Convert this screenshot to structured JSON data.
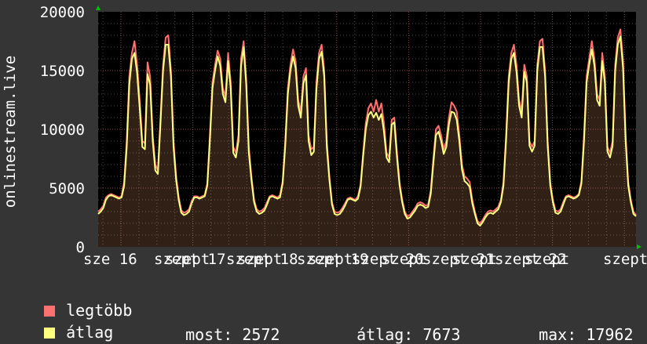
{
  "chart_data": {
    "type": "area",
    "ylabel": "onlinestream.live",
    "ylim": [
      0,
      20000
    ],
    "yticks": [
      0,
      5000,
      10000,
      15000,
      20000
    ],
    "ytick_labels": [
      "0",
      "5000",
      "10000",
      "15000",
      "20000"
    ],
    "x_tick_labels": [
      "sze 16",
      "szept 17",
      "szept 18",
      "szept 19",
      "szept 20",
      "szept 21",
      "szept 22",
      "szept"
    ],
    "x_tick_overlap_labels": [
      "szept",
      "szept",
      "szept",
      "szept",
      "szept",
      "szept"
    ],
    "grid": true,
    "background": "#000000",
    "series": [
      {
        "name": "legtöbb",
        "color": "#ff7070",
        "values": [
          3000,
          3200,
          3500,
          4200,
          4400,
          4500,
          4400,
          4300,
          4200,
          4300,
          5500,
          9000,
          14500,
          16500,
          17500,
          15500,
          12500,
          9000,
          8800,
          15700,
          14500,
          9500,
          7000,
          6500,
          11000,
          15500,
          17800,
          18000,
          15000,
          9000,
          6000,
          4200,
          3100,
          2900,
          3000,
          3200,
          3900,
          4300,
          4300,
          4200,
          4300,
          4400,
          5400,
          9500,
          14000,
          15500,
          16700,
          16000,
          13500,
          12800,
          16500,
          14000,
          8500,
          8000,
          9500,
          16000,
          17500,
          14200,
          8500,
          6000,
          4000,
          3200,
          3000,
          3100,
          3300,
          3800,
          4300,
          4400,
          4300,
          4200,
          4400,
          5600,
          9000,
          13500,
          15500,
          16800,
          15800,
          12500,
          11500,
          14500,
          15200,
          9500,
          8300,
          8500,
          14000,
          16500,
          17200,
          15000,
          9000,
          6000,
          3800,
          3000,
          2900,
          3000,
          3300,
          3700,
          4100,
          4200,
          4100,
          4000,
          4300,
          5300,
          8000,
          10500,
          11800,
          12200,
          11500,
          12500,
          11500,
          12200,
          10500,
          8000,
          7600,
          10800,
          11000,
          8000,
          5500,
          4000,
          3000,
          2600,
          2700,
          3000,
          3300,
          3700,
          3800,
          3700,
          3500,
          3600,
          4800,
          7500,
          10000,
          10300,
          9500,
          8300,
          9000,
          11000,
          12300,
          12000,
          11500,
          9500,
          7000,
          6000,
          5800,
          5500,
          4000,
          3000,
          2200,
          2000,
          2300,
          2700,
          3000,
          3100,
          3000,
          3200,
          3400,
          4000,
          5500,
          9500,
          14500,
          16500,
          17200,
          15500,
          12500,
          11500,
          15500,
          14500,
          9000,
          8500,
          9000,
          15500,
          17500,
          17700,
          15000,
          9000,
          5500,
          4000,
          3100,
          3000,
          3200,
          3800,
          4300,
          4400,
          4300,
          4200,
          4300,
          4500,
          5600,
          9500,
          14500,
          16000,
          17500,
          16000,
          13000,
          12500,
          16500,
          14500,
          8500,
          8000,
          9000,
          15500,
          17800,
          18500,
          15800,
          9500,
          5500,
          4000,
          3000,
          2700
        ]
      },
      {
        "name": "átlag",
        "color": "#ffff80",
        "values": [
          2800,
          3000,
          3300,
          4000,
          4300,
          4400,
          4300,
          4200,
          4100,
          4200,
          5200,
          8500,
          13800,
          16000,
          16500,
          14800,
          11800,
          8500,
          8300,
          14700,
          13800,
          9000,
          6500,
          6200,
          10500,
          15000,
          17200,
          17200,
          14500,
          8500,
          5700,
          4000,
          2900,
          2700,
          2800,
          3000,
          3700,
          4200,
          4200,
          4100,
          4200,
          4300,
          5200,
          9000,
          13500,
          15000,
          16200,
          15400,
          13000,
          12300,
          15800,
          13500,
          8000,
          7600,
          9000,
          15400,
          17000,
          13800,
          8000,
          5700,
          3800,
          3000,
          2800,
          2900,
          3100,
          3600,
          4200,
          4300,
          4200,
          4100,
          4200,
          5400,
          8600,
          13000,
          15000,
          16200,
          15200,
          12000,
          11000,
          13900,
          14600,
          9000,
          7800,
          8100,
          13400,
          16000,
          16600,
          14500,
          8500,
          5700,
          3600,
          2800,
          2700,
          2800,
          3100,
          3500,
          4000,
          4100,
          4000,
          3900,
          4100,
          5100,
          7700,
          10000,
          11200,
          11500,
          11000,
          11400,
          10800,
          11300,
          9800,
          7600,
          7200,
          10400,
          10600,
          7600,
          5200,
          3800,
          2800,
          2400,
          2500,
          2800,
          3100,
          3500,
          3600,
          3500,
          3300,
          3400,
          4500,
          7100,
          9500,
          9800,
          9000,
          7900,
          8500,
          10400,
          11500,
          11400,
          10800,
          9000,
          6600,
          5600,
          5400,
          5100,
          3700,
          2800,
          2000,
          1800,
          2100,
          2500,
          2800,
          2900,
          2800,
          3000,
          3200,
          3800,
          5200,
          9000,
          14000,
          16000,
          16500,
          14900,
          12000,
          11000,
          14900,
          14000,
          8600,
          8100,
          8600,
          15000,
          17000,
          17000,
          14500,
          8600,
          5200,
          3800,
          2900,
          2800,
          3000,
          3600,
          4200,
          4300,
          4200,
          4100,
          4200,
          4400,
          5400,
          9000,
          14000,
          15500,
          16800,
          15400,
          12500,
          12000,
          15800,
          14000,
          8100,
          7600,
          8600,
          15000,
          17200,
          17900,
          15200,
          9000,
          5200,
          3800,
          2800,
          2600
        ]
      }
    ]
  },
  "legend": {
    "items": [
      {
        "label": "legtöbb",
        "color": "#ff7070"
      },
      {
        "label": "átlag",
        "color": "#ffff80"
      }
    ],
    "stats": {
      "now_label": "most:",
      "now_value": "2572",
      "avg_label": "átlag:",
      "avg_value": "7673",
      "max_label": "max:",
      "max_value": "17962"
    }
  }
}
